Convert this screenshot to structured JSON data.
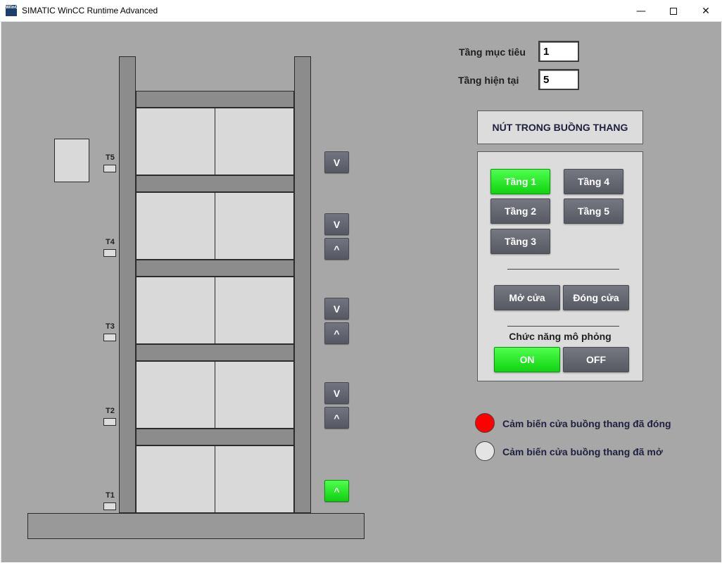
{
  "window": {
    "title": "SIMATIC WinCC Runtime Advanced",
    "icon_text": "WinCC",
    "minimize_glyph": "—",
    "close_glyph": "✕"
  },
  "building": {
    "floors": [
      {
        "label": "T5"
      },
      {
        "label": "T4"
      },
      {
        "label": "T3"
      },
      {
        "label": "T2"
      },
      {
        "label": "T1"
      }
    ],
    "call_buttons": [
      {
        "id": "t5-down",
        "glyph": "V",
        "active": false
      },
      {
        "id": "t4-down",
        "glyph": "V",
        "active": false
      },
      {
        "id": "t4-up",
        "glyph": "^",
        "active": false
      },
      {
        "id": "t3-down",
        "glyph": "V",
        "active": false
      },
      {
        "id": "t3-up",
        "glyph": "^",
        "active": false
      },
      {
        "id": "t2-down",
        "glyph": "V",
        "active": false
      },
      {
        "id": "t2-up",
        "glyph": "^",
        "active": false
      },
      {
        "id": "t1-up",
        "glyph": "^",
        "active": true
      }
    ]
  },
  "status": {
    "target_floor_label": "Tầng mục tiêu",
    "target_floor_value": "1",
    "current_floor_label": "Tầng hiện tại",
    "current_floor_value": "5"
  },
  "cabin_panel": {
    "title": "NÚT TRONG BUỒNG THANG",
    "floor_buttons": [
      {
        "label": "Tầng 1",
        "active": true
      },
      {
        "label": "Tầng 4",
        "active": false
      },
      {
        "label": "Tầng 2",
        "active": false
      },
      {
        "label": "Tầng 5",
        "active": false
      },
      {
        "label": "Tầng 3",
        "active": false
      }
    ],
    "open_door_label": "Mở cửa",
    "close_door_label": "Đóng cửa",
    "simulation_title": "Chức năng mô phỏng",
    "sim_on_label": "ON",
    "sim_off_label": "OFF",
    "sim_on_active": true
  },
  "sensors": [
    {
      "label": "Cảm biến cửa buồng thang đã đóng",
      "state": "active",
      "color": "#ff0000"
    },
    {
      "label": "Cảm biến cửa buồng thang đã mở",
      "state": "inactive",
      "color": "#e4e4e4"
    }
  ]
}
